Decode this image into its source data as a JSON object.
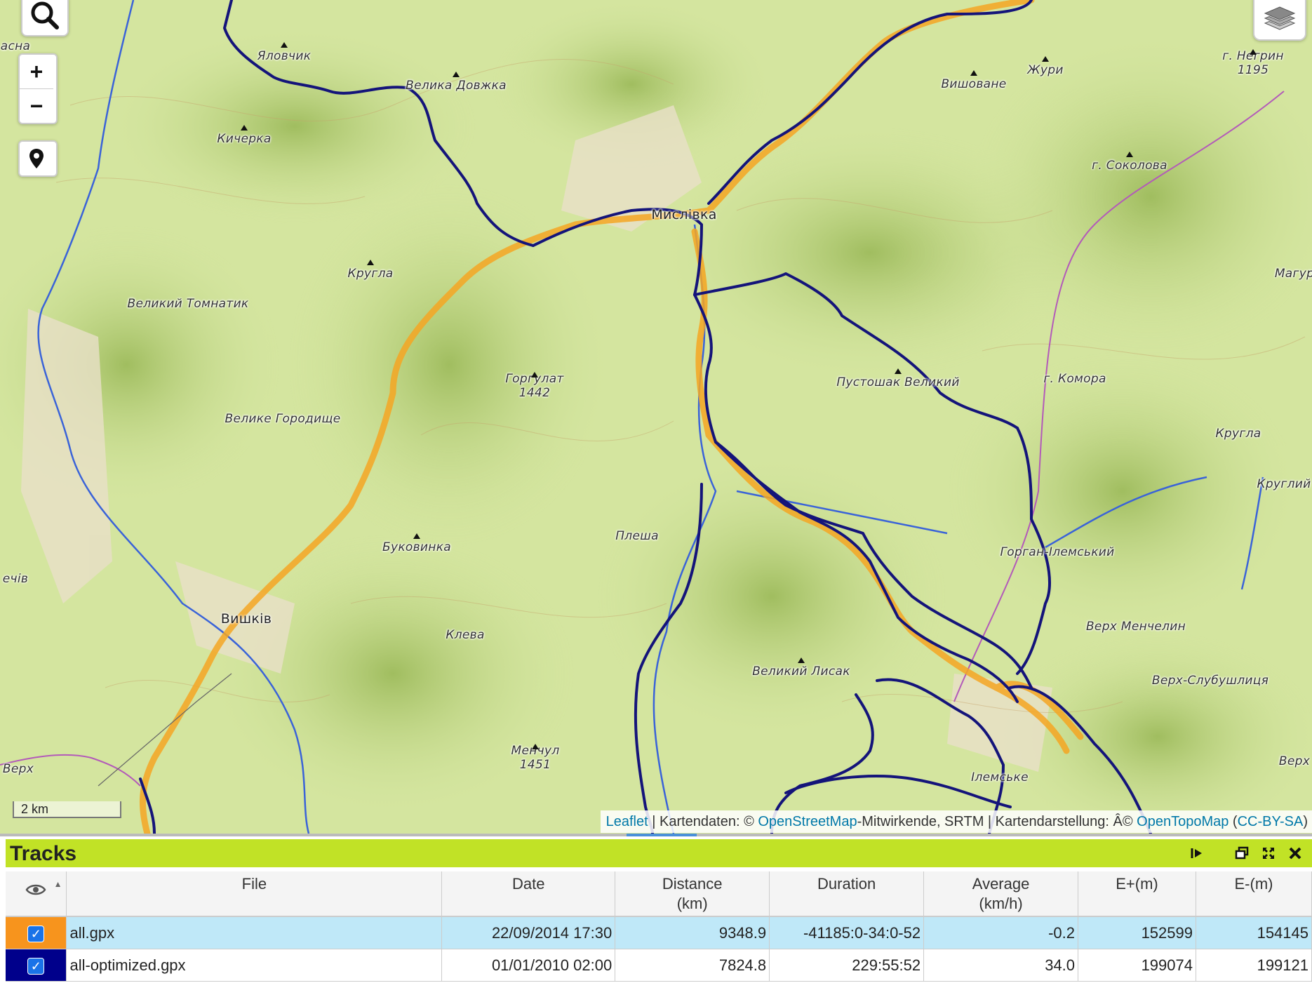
{
  "map": {
    "places": [
      {
        "name": "Яловчик",
        "kind": "peak"
      },
      {
        "name": "Велика Довжка",
        "kind": "peak"
      },
      {
        "name": "Кичерка",
        "kind": "peak"
      },
      {
        "name": "Кругла",
        "kind": "peak"
      },
      {
        "name": "Великий Томнатик",
        "kind": "label"
      },
      {
        "name": "Велике Городище",
        "kind": "label"
      },
      {
        "name": "Горгулат\n1442",
        "kind": "peak"
      },
      {
        "name": "Мислівка",
        "kind": "town"
      },
      {
        "name": "Вишоване",
        "kind": "peak"
      },
      {
        "name": "Жури",
        "kind": "peak"
      },
      {
        "name": "г. Негрин\n1195",
        "kind": "peak"
      },
      {
        "name": "г. Соколова",
        "kind": "peak"
      },
      {
        "name": "Магур",
        "kind": "label"
      },
      {
        "name": "Пустошак Великий",
        "kind": "peak"
      },
      {
        "name": "г. Комора",
        "kind": "label"
      },
      {
        "name": "Кругла",
        "kind": "label"
      },
      {
        "name": "Круглий",
        "kind": "label"
      },
      {
        "name": "Буковинка",
        "kind": "peak"
      },
      {
        "name": "Плеша",
        "kind": "label"
      },
      {
        "name": "Горган-Ілемський",
        "kind": "label"
      },
      {
        "name": "Верх Менчелин",
        "kind": "label"
      },
      {
        "name": "Верх-Слубушлиця",
        "kind": "label"
      },
      {
        "name": "Великий Лисак",
        "kind": "peak"
      },
      {
        "name": "Клева",
        "kind": "label"
      },
      {
        "name": "Вишків",
        "kind": "town"
      },
      {
        "name": "ечів",
        "kind": "label"
      },
      {
        "name": "Менчул\n1451",
        "kind": "peak"
      },
      {
        "name": "Верх",
        "kind": "label"
      },
      {
        "name": "Верх",
        "kind": "label"
      },
      {
        "name": "Ілемське",
        "kind": "label"
      },
      {
        "name": "асна",
        "kind": "label"
      }
    ],
    "scale_label": "2 km",
    "attribution": {
      "leaflet": "Leaflet",
      "sep1": " | Kartendaten: © ",
      "osm": "OpenStreetMap",
      "mid": "-Mitwirkende, SRTM | Kartendarstellung: Â© ",
      "otm": "OpenTopoMap",
      "open": " (",
      "license": "CC-BY-SA",
      "close": ")"
    },
    "controls": {
      "zoom_in": "+",
      "zoom_out": "−"
    },
    "colors": {
      "track_all": "#f5a623",
      "track_optimized": "#14147a",
      "river": "#3a63d8",
      "terrain": "#cfe29a"
    }
  },
  "panel": {
    "title": "Tracks",
    "columns": [
      "File",
      "Date",
      "Distance\n(km)",
      "Duration",
      "Average\n(km/h)",
      "E+(m)",
      "E-(m)"
    ],
    "rows": [
      {
        "color": "#f7941d",
        "checked": true,
        "file": "all.gpx",
        "date": "22/09/2014 17:30",
        "distance": "9348.9",
        "duration": "-41185:0-34:0-52",
        "average": "-0.2",
        "eplus": "152599",
        "eminus": "154145"
      },
      {
        "color": "#00008b",
        "checked": true,
        "file": "all-optimized.gpx",
        "date": "01/01/2010 02:00",
        "distance": "7824.8",
        "duration": "229:55:52",
        "average": "34.0",
        "eplus": "199074",
        "eminus": "199121"
      }
    ]
  }
}
